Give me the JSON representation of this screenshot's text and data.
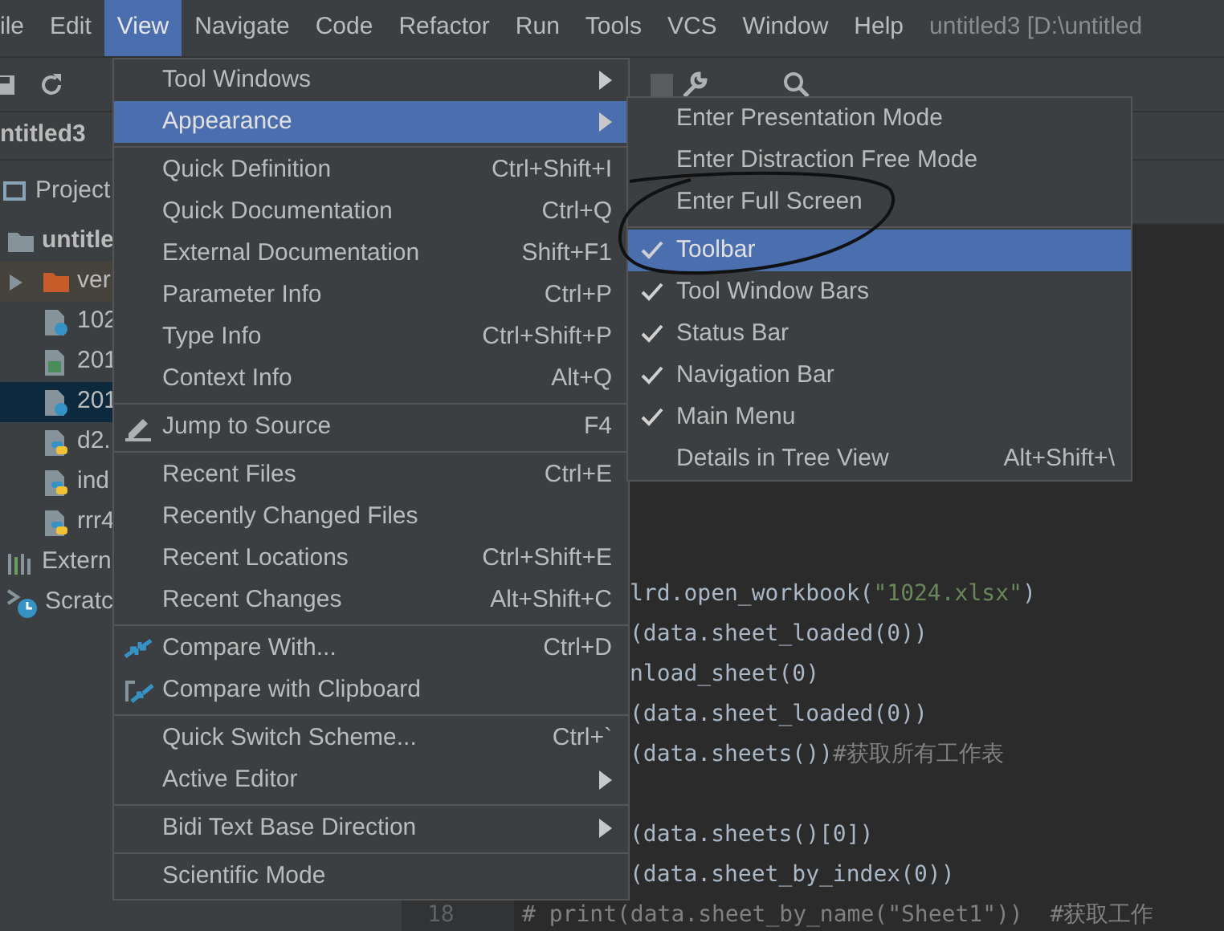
{
  "menu_bar": {
    "items": [
      {
        "label": "ile",
        "selected": false
      },
      {
        "label": "Edit",
        "selected": false
      },
      {
        "label": "View",
        "selected": true
      },
      {
        "label": "Navigate",
        "selected": false
      },
      {
        "label": "Code",
        "selected": false
      },
      {
        "label": "Refactor",
        "selected": false
      },
      {
        "label": "Run",
        "selected": false
      },
      {
        "label": "Tools",
        "selected": false
      },
      {
        "label": "VCS",
        "selected": false
      },
      {
        "label": "Window",
        "selected": false
      },
      {
        "label": "Help",
        "selected": false
      }
    ],
    "title": "untitled3 [D:\\untitled"
  },
  "navigation_bar": {
    "breadcrumb": "ntitled3"
  },
  "project_panel": {
    "title": "Project",
    "tree": [
      {
        "label": "untitle",
        "kind": "folder",
        "selected": false,
        "children": [
          {
            "label": "ver",
            "kind": "excluded-folder",
            "selected": false,
            "expanded": false
          },
          {
            "label": "102",
            "kind": "unknown-file",
            "selected": false
          },
          {
            "label": "201",
            "kind": "image-file",
            "selected": false
          },
          {
            "label": "201",
            "kind": "unknown-file",
            "selected": true
          },
          {
            "label": "d2.",
            "kind": "python-file",
            "selected": false
          },
          {
            "label": "ind",
            "kind": "python-file",
            "selected": false
          },
          {
            "label": "rrr4",
            "kind": "python-file",
            "selected": false
          }
        ]
      },
      {
        "label": "Extern",
        "kind": "library",
        "selected": false
      },
      {
        "label": "Scratc",
        "kind": "scratches",
        "selected": false
      }
    ]
  },
  "editor": {
    "lines": [
      {
        "kind": "tail",
        "segments": [
          {
            "kind": "code",
            "text": "lrd.open_workbook("
          },
          {
            "kind": "string",
            "text": "\"1024.xlsx\""
          },
          {
            "kind": "code",
            "text": ")"
          }
        ]
      },
      {
        "kind": "tail",
        "segments": [
          {
            "kind": "code",
            "text": "(data.sheet_loaded(0))"
          }
        ]
      },
      {
        "kind": "tail",
        "segments": [
          {
            "kind": "code",
            "text": "nload_sheet(0)"
          }
        ]
      },
      {
        "kind": "tail",
        "segments": [
          {
            "kind": "code",
            "text": "(data.sheet_loaded(0))"
          }
        ]
      },
      {
        "kind": "tail",
        "segments": [
          {
            "kind": "code",
            "text": "(data.sheets())"
          },
          {
            "kind": "comment",
            "text": "#获取所有工作表"
          }
        ]
      },
      {
        "kind": "blank"
      },
      {
        "kind": "tail",
        "segments": [
          {
            "kind": "code",
            "text": "(data.sheets()[0])"
          }
        ]
      },
      {
        "kind": "tail",
        "segments": [
          {
            "kind": "code",
            "text": "(data.sheet_by_index(0))"
          }
        ]
      },
      {
        "kind": "full",
        "number": "18",
        "segments": [
          {
            "kind": "comment",
            "text": "# print(data.sheet_by_name(\"Sheet1\"))  #获取工作"
          }
        ]
      }
    ]
  },
  "view_menu": {
    "items": [
      {
        "kind": "item",
        "label": "Tool Windows",
        "submenu": true,
        "selected": false
      },
      {
        "kind": "item",
        "label": "Appearance",
        "submenu": true,
        "selected": true
      },
      {
        "kind": "separator"
      },
      {
        "kind": "item",
        "label": "Quick Definition",
        "shortcut": "Ctrl+Shift+I",
        "selected": false
      },
      {
        "kind": "item",
        "label": "Quick Documentation",
        "shortcut": "Ctrl+Q",
        "selected": false
      },
      {
        "kind": "item",
        "label": "External Documentation",
        "shortcut": "Shift+F1",
        "selected": false
      },
      {
        "kind": "item",
        "label": "Parameter Info",
        "shortcut": "Ctrl+P",
        "selected": false
      },
      {
        "kind": "item",
        "label": "Type Info",
        "shortcut": "Ctrl+Shift+P",
        "selected": false
      },
      {
        "kind": "item",
        "label": "Context Info",
        "shortcut": "Alt+Q",
        "selected": false
      },
      {
        "kind": "separator"
      },
      {
        "kind": "item",
        "label": "Jump to Source",
        "shortcut": "F4",
        "selected": false
      },
      {
        "kind": "separator"
      },
      {
        "kind": "item",
        "label": "Recent Files",
        "shortcut": "Ctrl+E",
        "selected": false
      },
      {
        "kind": "item",
        "label": "Recently Changed Files",
        "selected": false
      },
      {
        "kind": "item",
        "label": "Recent Locations",
        "shortcut": "Ctrl+Shift+E",
        "selected": false
      },
      {
        "kind": "item",
        "label": "Recent Changes",
        "shortcut": "Alt+Shift+C",
        "selected": false
      },
      {
        "kind": "separator"
      },
      {
        "kind": "item",
        "label": "Compare With...",
        "shortcut": "Ctrl+D",
        "selected": false
      },
      {
        "kind": "item",
        "label": "Compare with Clipboard",
        "selected": false
      },
      {
        "kind": "separator"
      },
      {
        "kind": "item",
        "label": "Quick Switch Scheme...",
        "shortcut": "Ctrl+`",
        "selected": false
      },
      {
        "kind": "item",
        "label": "Active Editor",
        "submenu": true,
        "selected": false
      },
      {
        "kind": "separator"
      },
      {
        "kind": "item",
        "label": "Bidi Text Base Direction",
        "submenu": true,
        "selected": false
      },
      {
        "kind": "separator"
      },
      {
        "kind": "item",
        "label": "Scientific Mode",
        "selected": false
      }
    ]
  },
  "appearance_submenu": {
    "items": [
      {
        "kind": "item",
        "label": "Enter Presentation Mode",
        "checked": false,
        "selected": false
      },
      {
        "kind": "item",
        "label": "Enter Distraction Free Mode",
        "checked": false,
        "selected": false
      },
      {
        "kind": "item",
        "label": "Enter Full Screen",
        "checked": false,
        "selected": false
      },
      {
        "kind": "separator"
      },
      {
        "kind": "item",
        "label": "Toolbar",
        "checked": true,
        "selected": true
      },
      {
        "kind": "item",
        "label": "Tool Window Bars",
        "checked": true,
        "selected": false
      },
      {
        "kind": "item",
        "label": "Status Bar",
        "checked": true,
        "selected": false
      },
      {
        "kind": "item",
        "label": "Navigation Bar",
        "checked": true,
        "selected": false
      },
      {
        "kind": "item",
        "label": "Main Menu",
        "checked": true,
        "selected": false
      },
      {
        "kind": "item",
        "label": "Details in Tree View",
        "shortcut": "Alt+Shift+\\",
        "checked": false,
        "selected": false
      }
    ]
  }
}
